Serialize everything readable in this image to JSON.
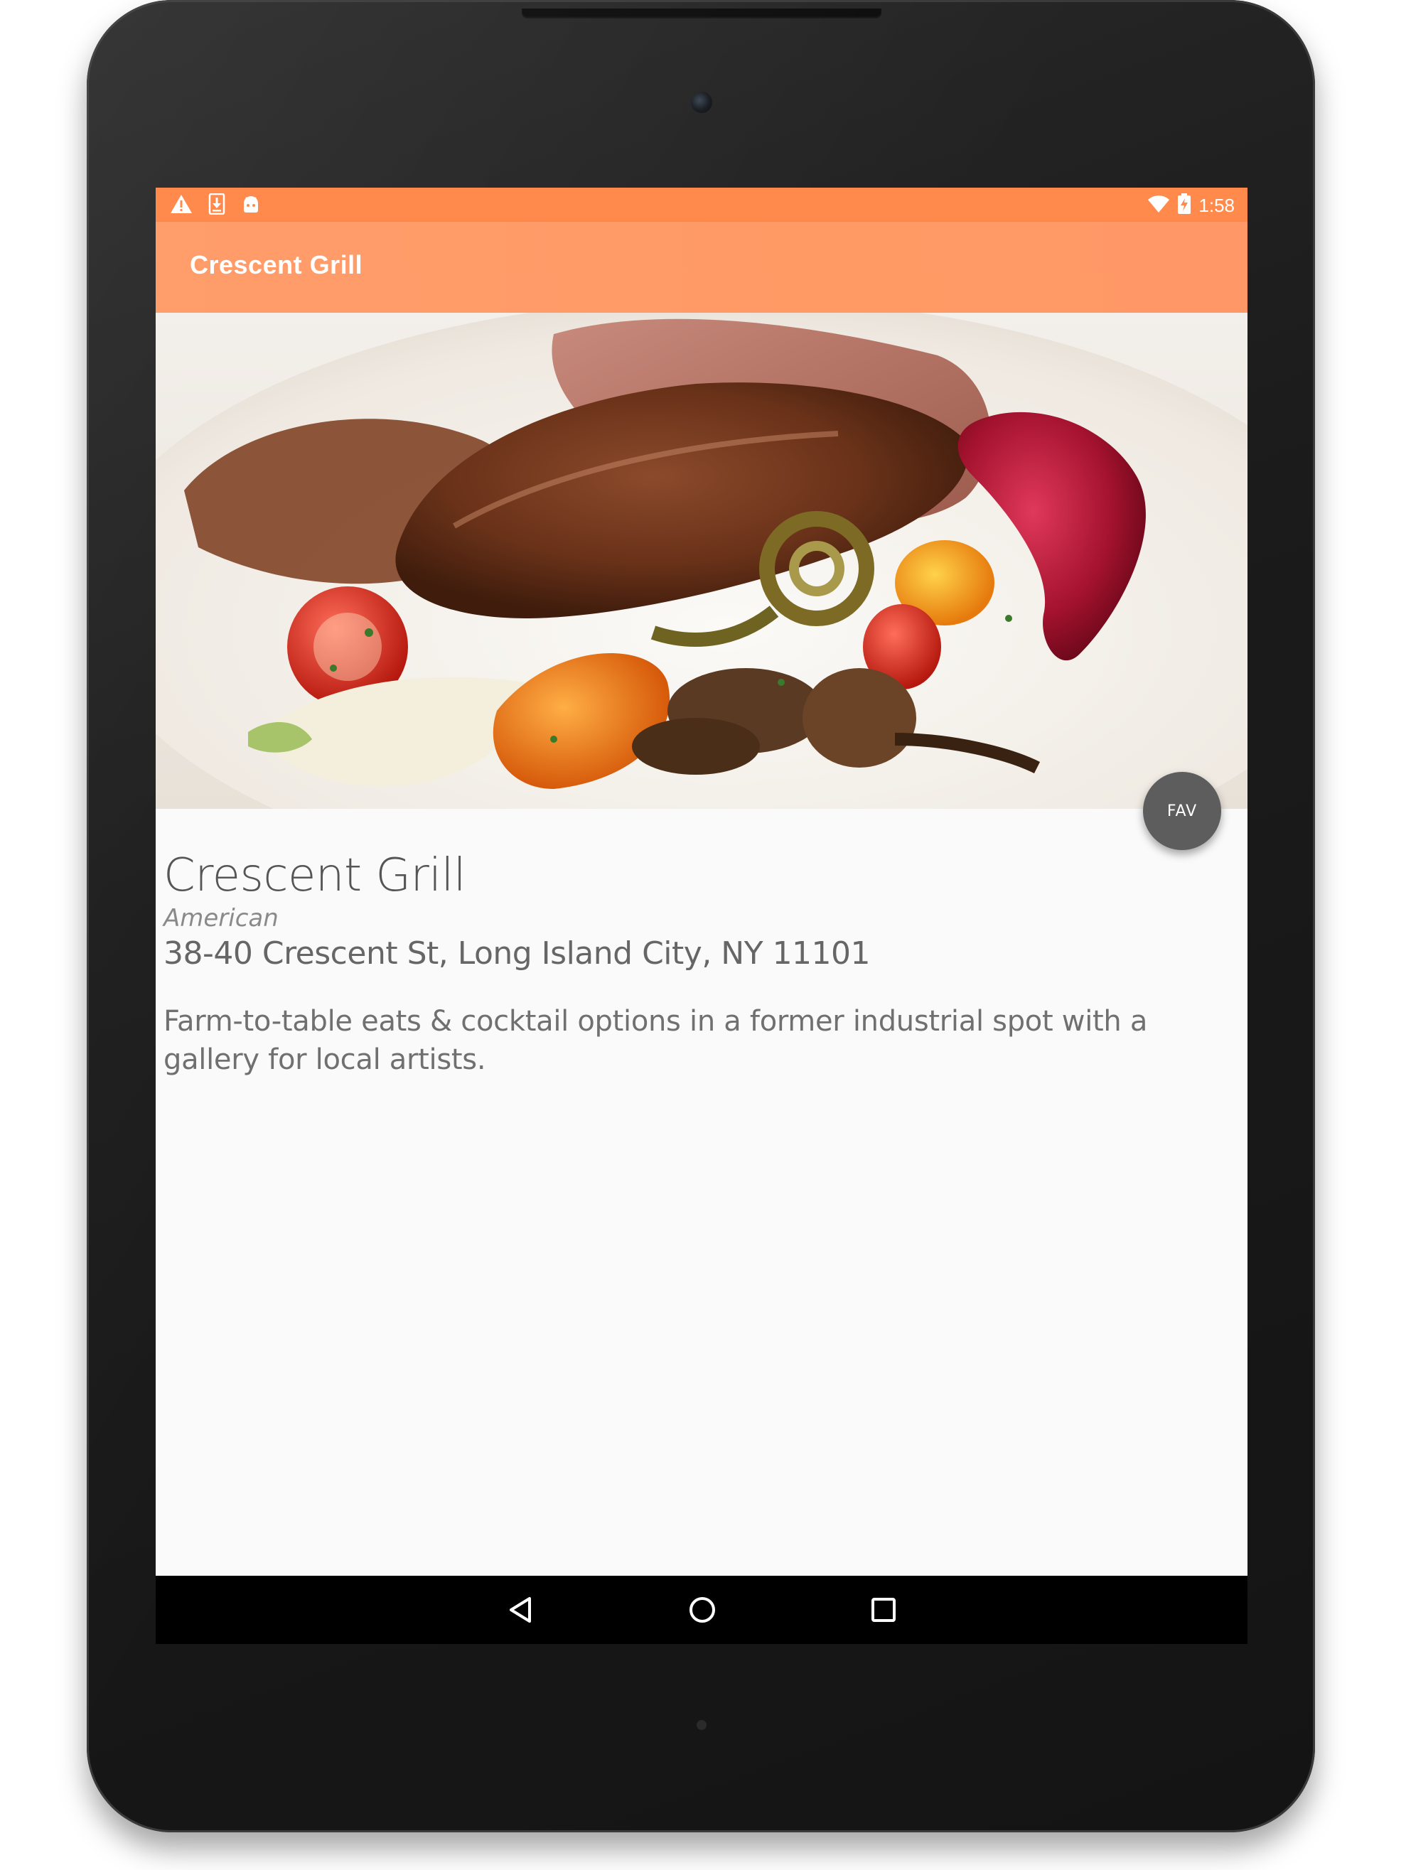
{
  "status_bar": {
    "left_icons": [
      "warning-icon",
      "download-icon",
      "android-icon"
    ],
    "right_icons": [
      "wifi-icon",
      "battery-icon"
    ],
    "time": "1:58",
    "color": "#ff8a4c"
  },
  "app_bar": {
    "title": "Crescent Grill",
    "color": "#ff9d6b"
  },
  "hero_image": {
    "subject": "plated duck breast with roasted vegetables and berry sauce"
  },
  "fab": {
    "label": "FAV",
    "color": "#5d5d5d"
  },
  "restaurant": {
    "name": "Crescent Grill",
    "cuisine": "American",
    "address": "38-40 Crescent St, Long Island City, NY 11101",
    "description": "Farm-to-table eats & cocktail options in a former industrial spot with a gallery for local artists."
  },
  "nav_bar": {
    "buttons": [
      "back-icon",
      "home-icon",
      "recents-icon"
    ]
  }
}
